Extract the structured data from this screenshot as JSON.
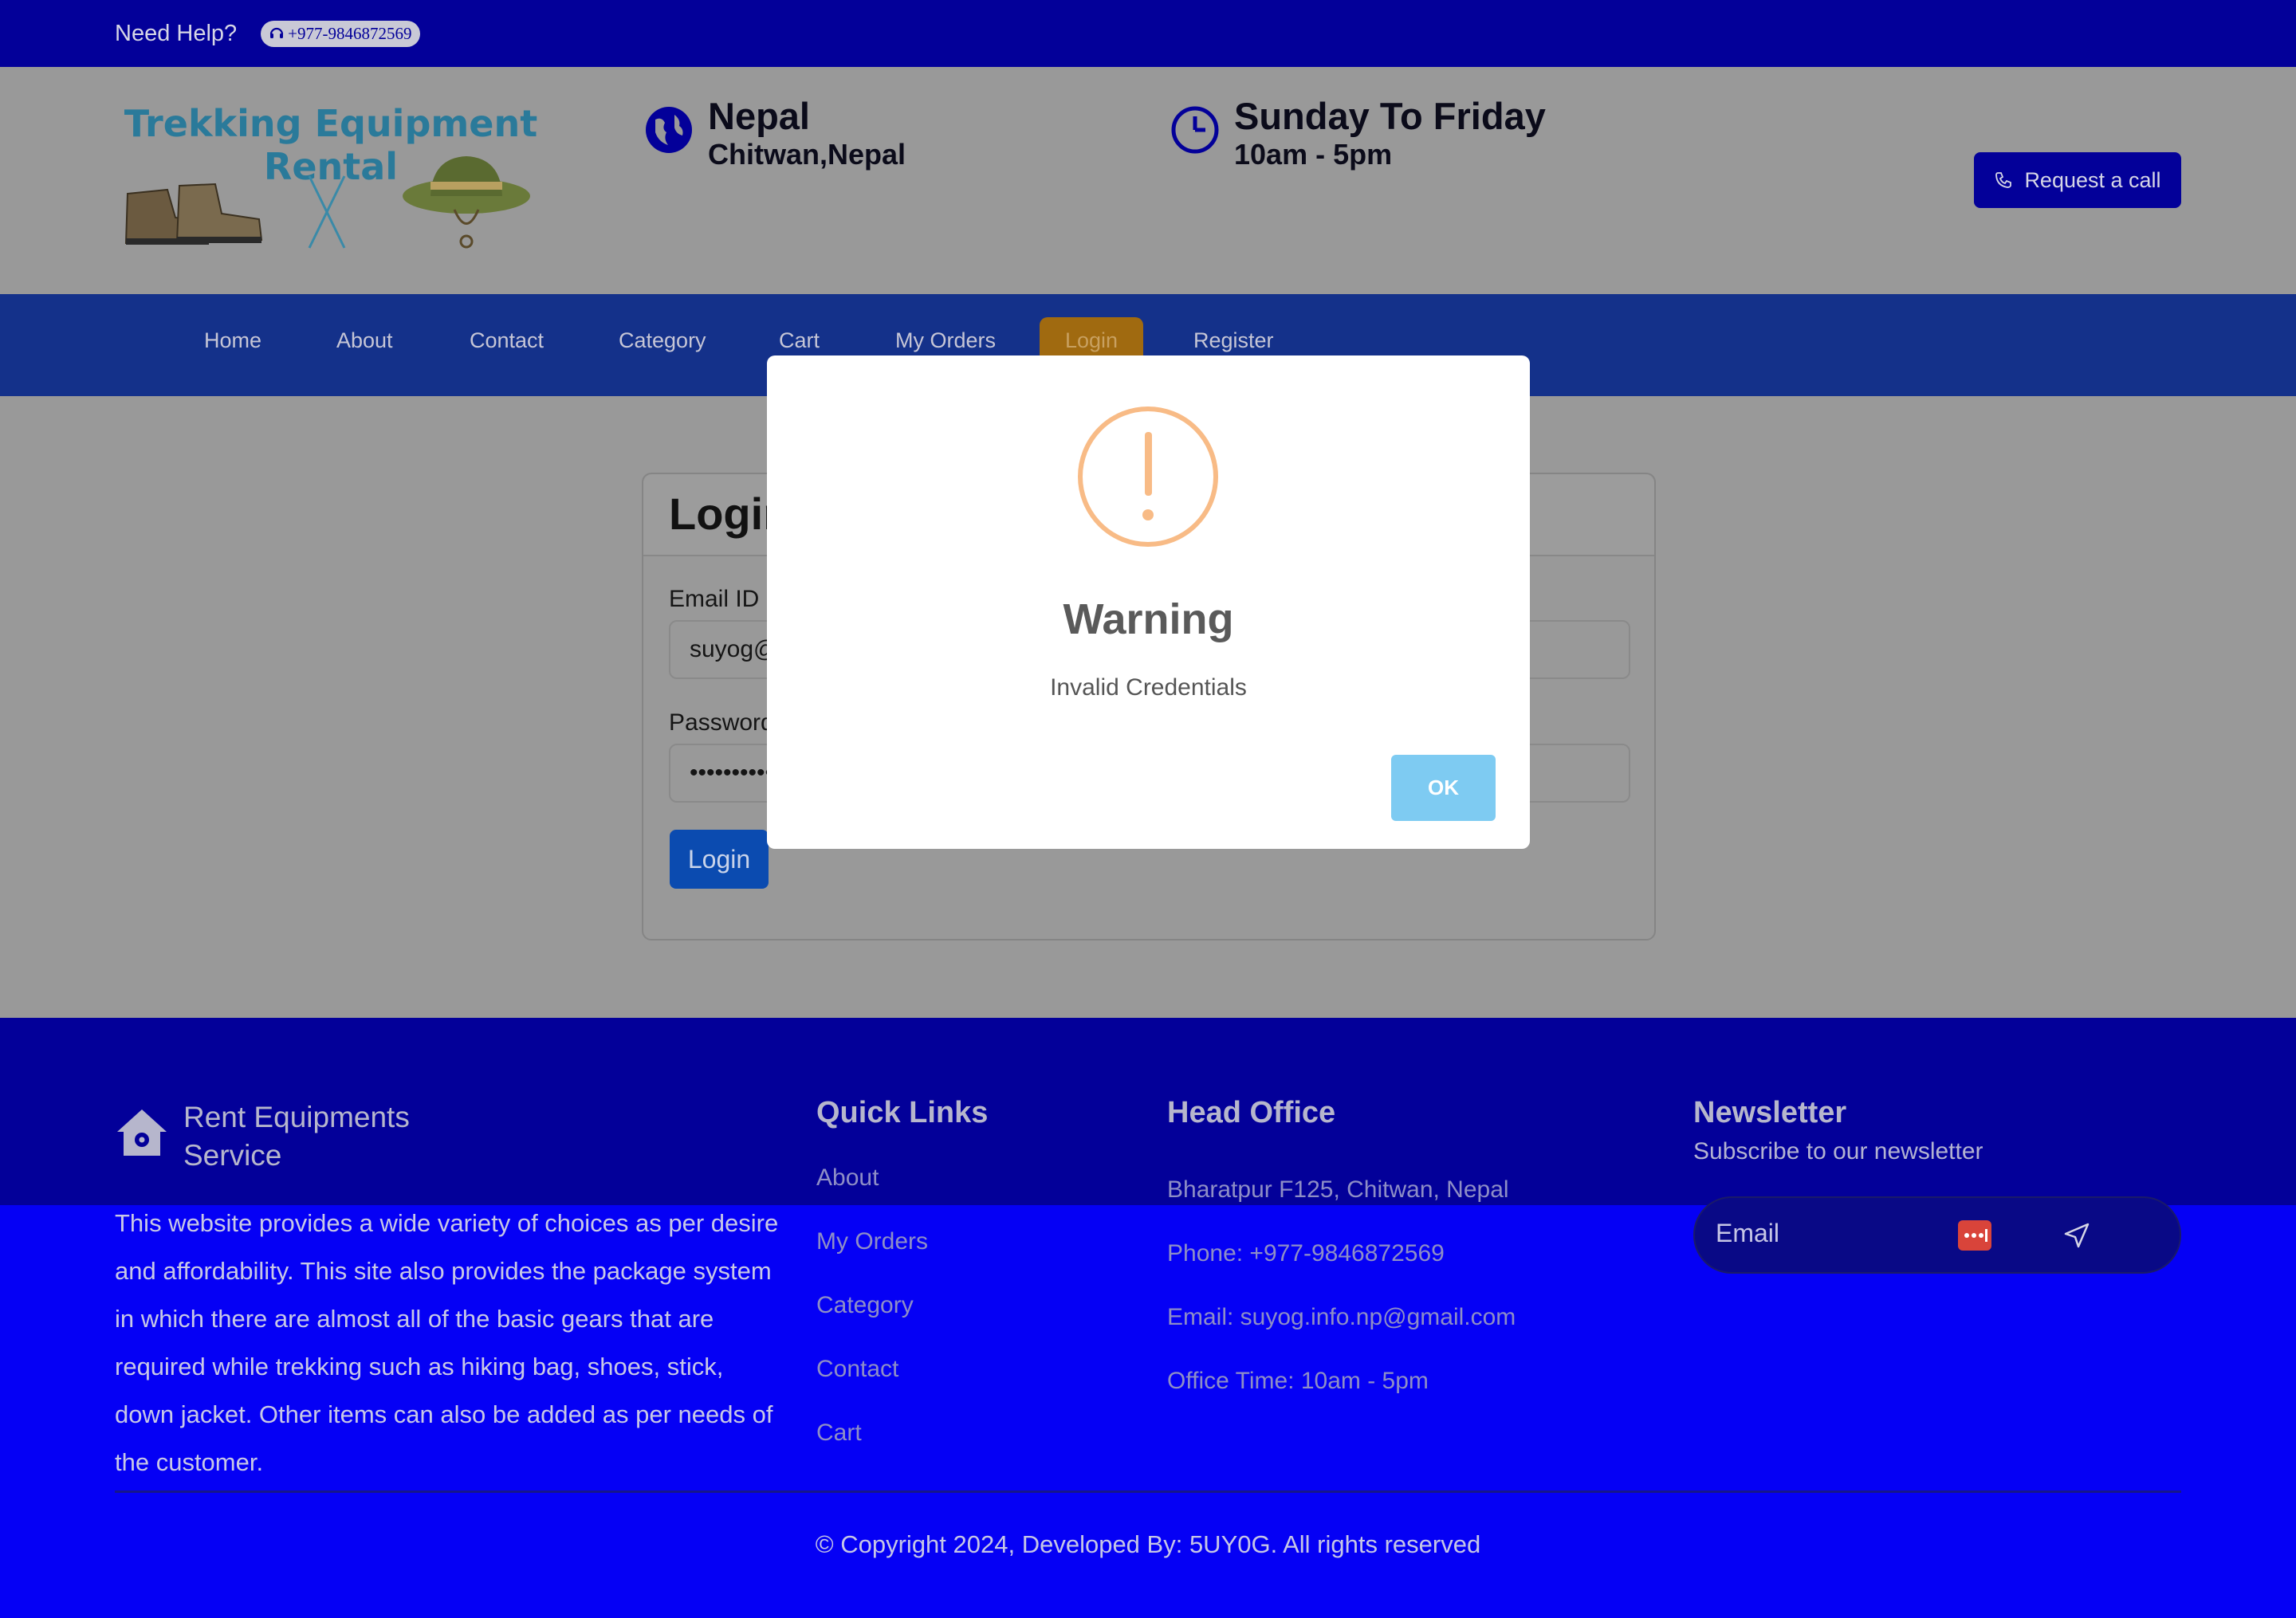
{
  "topbar": {
    "need_help": "Need Help?",
    "phone": "+977-9846872569"
  },
  "logo": {
    "line1": "Trekking Equipment",
    "line2": "Rental"
  },
  "header": {
    "location_title": "Nepal",
    "location_sub": "Chitwan,Nepal",
    "hours_title": "Sunday To Friday",
    "hours_sub": "10am - 5pm",
    "request_btn": "Request a call"
  },
  "nav": {
    "items": [
      "Home",
      "About",
      "Contact",
      "Category",
      "Cart",
      "My Orders",
      "Login",
      "Register"
    ],
    "active": "Login"
  },
  "login_form": {
    "title": "Login",
    "email_label": "Email ID",
    "email_value": "suyog@",
    "password_label": "Password",
    "password_value": "••••••••••",
    "submit": "Login"
  },
  "modal": {
    "title": "Warning",
    "message": "Invalid Credentials",
    "ok": "OK",
    "accent": "#f8bb86"
  },
  "footer": {
    "brand_line1": "Rent Equipments",
    "brand_line2": "Service",
    "description": "This website provides a wide variety of choices as per desire and affordability. This site also provides the package system in which there are almost all of the basic gears that are required while trekking such as hiking bag, shoes, stick, down jacket. Other items can also be added as per needs of the customer.",
    "quick_links_title": "Quick Links",
    "quick_links": [
      "About",
      "My Orders",
      "Category",
      "Contact",
      "Cart"
    ],
    "office_title": "Head Office",
    "office_address": "Bharatpur F125, Chitwan, Nepal",
    "office_phone": "Phone: +977-9846872569",
    "office_email": "Email: suyog.info.np@gmail.com",
    "office_time": "Office Time: 10am - 5pm",
    "newsletter_title": "Newsletter",
    "newsletter_sub": "Subscribe to our newsletter",
    "newsletter_placeholder": "Email",
    "copyright": "Copyright 2024, Developed By: 5UY0G. All rights reserved"
  }
}
